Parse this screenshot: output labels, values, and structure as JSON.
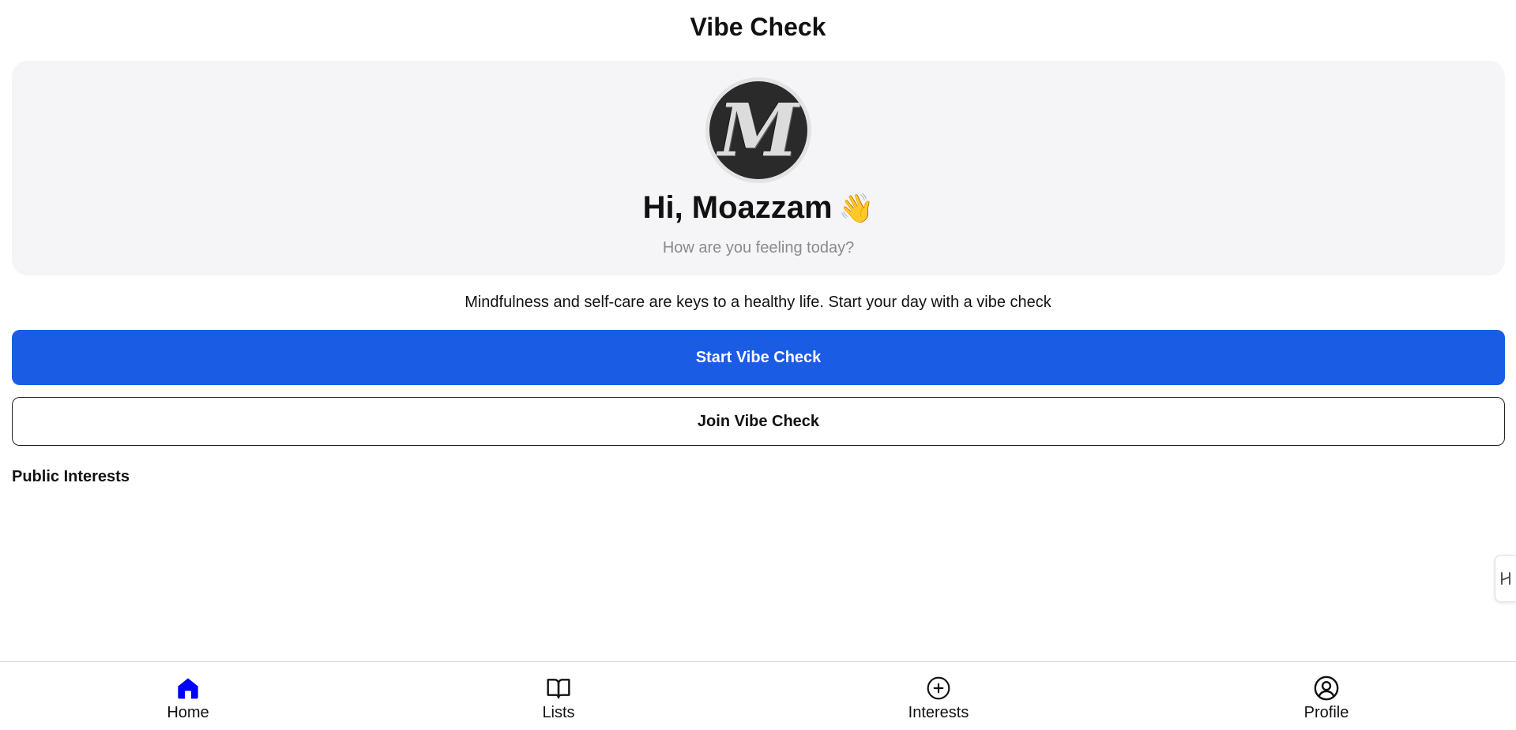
{
  "header": {
    "title": "Vibe Check"
  },
  "profile": {
    "avatar_letter": "M",
    "greeting": "Hi, Moazzam",
    "greeting_emoji": "👋",
    "subtitle": "How are you feeling today?"
  },
  "tagline": "Mindfulness and self-care are keys to a healthy life. Start your day with a vibe check",
  "actions": {
    "start_label": "Start Vibe Check",
    "join_label": "Join Vibe Check"
  },
  "sections": {
    "public_interests_heading": "Public Interests"
  },
  "bottom_nav": {
    "items": [
      {
        "label": "Home",
        "icon": "home-icon",
        "active": true
      },
      {
        "label": "Lists",
        "icon": "book-open-icon",
        "active": false
      },
      {
        "label": "Interests",
        "icon": "plus-circle-icon",
        "active": false
      },
      {
        "label": "Profile",
        "icon": "user-circle-icon",
        "active": false
      }
    ]
  },
  "colors": {
    "primary": "#1b5ce5",
    "active_nav": "#0000ff",
    "card_background": "#f5f5f7",
    "muted_text": "#8a8a8a"
  }
}
